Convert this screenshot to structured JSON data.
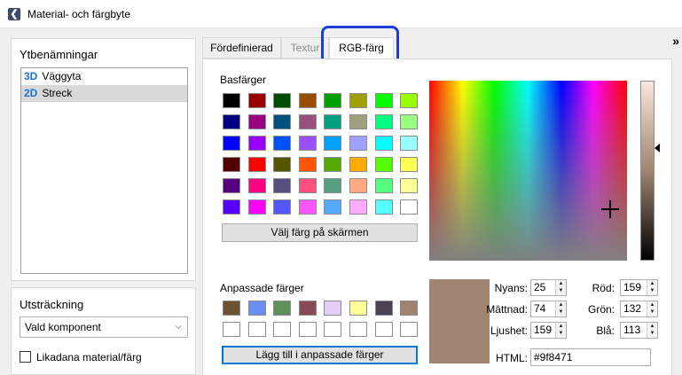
{
  "window": {
    "title": "Material- och färgbyte"
  },
  "left_panel": {
    "heading": "Ytbenämningar",
    "items": [
      {
        "dim": "3D",
        "label": "Väggyta",
        "selected": false
      },
      {
        "dim": "2D",
        "label": "Streck",
        "selected": true
      }
    ]
  },
  "extent_panel": {
    "heading": "Utsträckning",
    "select_value": "Vald komponent",
    "checkbox_label": "Likadana material/färg",
    "checkbox_checked": false
  },
  "tabs": [
    {
      "label": "Fördefinierad",
      "active": false
    },
    {
      "label": "Textur",
      "active": false
    },
    {
      "label": "RGB-färg",
      "active": true
    }
  ],
  "more_label": "»",
  "basic_colors": {
    "label": "Basfärger",
    "rows": [
      [
        "#000000",
        "#990000",
        "#004d00",
        "#994d00",
        "#00a000",
        "#a0a000",
        "#00ff00",
        "#99ff00"
      ],
      [
        "#000080",
        "#990080",
        "#005080",
        "#995080",
        "#00a080",
        "#a0a080",
        "#00ff80",
        "#99ff80"
      ],
      [
        "#0000ff",
        "#9900ff",
        "#0050ff",
        "#9950ff",
        "#00a0ff",
        "#a0a0ff",
        "#00ffff",
        "#99ffff"
      ],
      [
        "#550000",
        "#ff0000",
        "#555500",
        "#ff5500",
        "#55aa00",
        "#ffaa00",
        "#55ff00",
        "#ffff55"
      ],
      [
        "#550080",
        "#ff0080",
        "#555080",
        "#ff5080",
        "#55a080",
        "#ffaa80",
        "#55ff80",
        "#ffff99"
      ],
      [
        "#5500ff",
        "#ff00ff",
        "#5555ff",
        "#ff55ff",
        "#55aaff",
        "#ffaaff",
        "#55ffff",
        "#ffffff"
      ]
    ],
    "pick_button": "Välj färg på skärmen"
  },
  "custom_colors": {
    "label": "Anpassade färger",
    "rows": [
      [
        "#6a5131",
        "#6b8ef2",
        "#5c9159",
        "#8a4959",
        "#e5cdf8",
        "#ffff99",
        "#4a4252",
        "#9f8471"
      ],
      [
        "#ffffff",
        "#ffffff",
        "#ffffff",
        "#ffffff",
        "#ffffff",
        "#ffffff",
        "#ffffff",
        "#ffffff"
      ]
    ],
    "add_button": "Lägg till i anpassade färger"
  },
  "color": {
    "preview": "#9f8471",
    "hue_label": "Nyans:",
    "hue": "25",
    "sat_label": "Mättnad:",
    "sat": "74",
    "lum_label": "Ljushet:",
    "lum": "159",
    "red_label": "Röd:",
    "red": "159",
    "green_label": "Grön:",
    "green": "132",
    "blue_label": "Blå:",
    "blue": "113",
    "html_label": "HTML:",
    "html": "#9f8471"
  }
}
